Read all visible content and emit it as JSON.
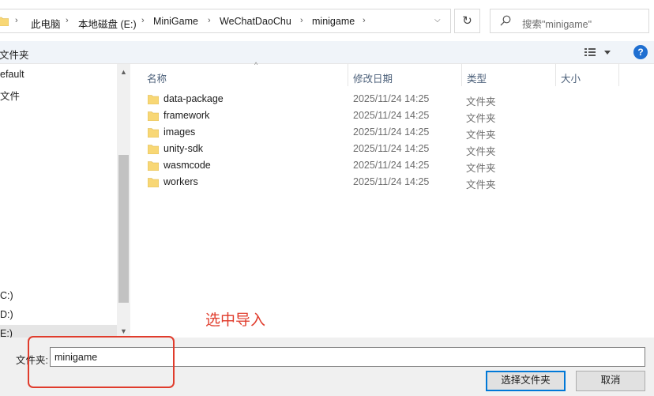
{
  "address": {
    "crumbs": [
      "此电脑",
      "本地磁盘 (E:)",
      "MiniGame",
      "WeChatDaoChu",
      "minigame"
    ],
    "chevron": "›",
    "dropdown_glyph": "⌵",
    "refresh_glyph": "↻"
  },
  "search": {
    "placeholder": "搜索\"minigame\""
  },
  "toolbar": {
    "new_folder": "文件夹",
    "help": "?"
  },
  "nav": {
    "items": [
      "efault",
      "文件",
      "C:)",
      "D:)",
      "E:)"
    ]
  },
  "list": {
    "columns": [
      "名称",
      "修改日期",
      "类型",
      "大小"
    ],
    "rows": [
      {
        "name": "data-package",
        "date": "2025/11/24 14:25",
        "type": "文件夹"
      },
      {
        "name": "framework",
        "date": "2025/11/24 14:25",
        "type": "文件夹"
      },
      {
        "name": "images",
        "date": "2025/11/24 14:25",
        "type": "文件夹"
      },
      {
        "name": "unity-sdk",
        "date": "2025/11/24 14:25",
        "type": "文件夹"
      },
      {
        "name": "wasmcode",
        "date": "2025/11/24 14:25",
        "type": "文件夹"
      },
      {
        "name": "workers",
        "date": "2025/11/24 14:25",
        "type": "文件夹"
      }
    ]
  },
  "annotation": "选中导入",
  "bottom": {
    "folder_label": "文件夹:",
    "folder_value": "minigame",
    "select_button": "选择文件夹",
    "cancel_button": "取消"
  },
  "colors": {
    "accent": "#0078d7",
    "annotation": "#e03c2c",
    "folder": "#f8d775"
  }
}
